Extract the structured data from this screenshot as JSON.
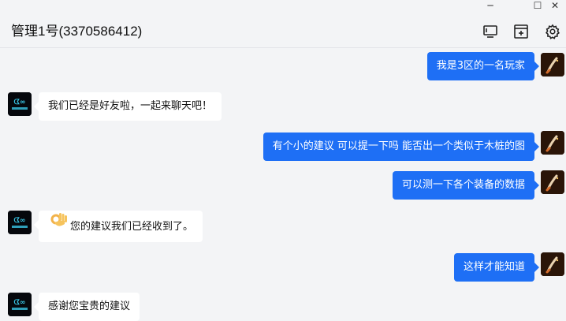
{
  "window": {
    "minimize_glyph": "─",
    "maximize_glyph": "☐",
    "close_glyph": "✕"
  },
  "header": {
    "title": "管理1号(3370586412)",
    "icons": [
      "screen-share-icon",
      "add-window-icon",
      "settings-gear-icon"
    ]
  },
  "messages": [
    {
      "side": "right",
      "text": "我是3区的一名玩家"
    },
    {
      "side": "left",
      "text": "我们已经是好友啦，一起来聊天吧！"
    },
    {
      "side": "right",
      "text": "有个小的建议 可以提一下吗 能否出一个类似于木桩的图"
    },
    {
      "side": "right",
      "text": "可以测一下各个装备的数据"
    },
    {
      "side": "left",
      "emoji": "ok-hand-icon",
      "text": "您的建议我们已经收到了。"
    },
    {
      "side": "right",
      "text": "这样才能知道"
    },
    {
      "side": "left",
      "text": "感谢您宝贵的建议"
    }
  ],
  "colors": {
    "accent_bubble": "#1e6ff5",
    "background": "#f3f4f6",
    "left_bubble": "#ffffff"
  }
}
